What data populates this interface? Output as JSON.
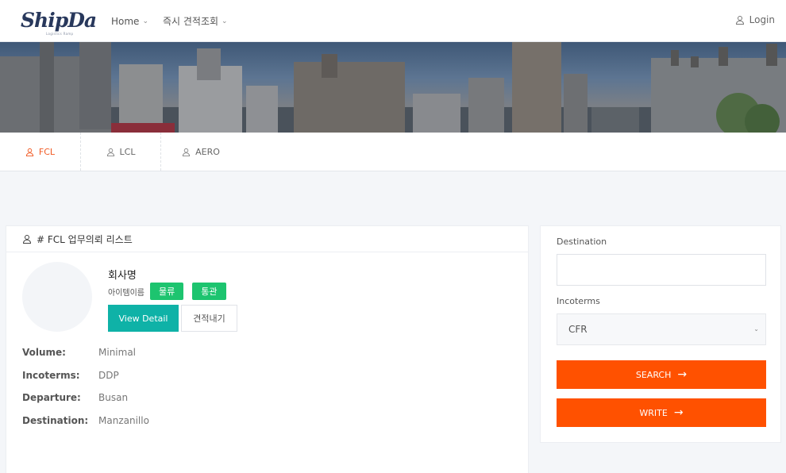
{
  "header": {
    "logo": "ShipDa",
    "logo_sub": "Logistics Ramp",
    "nav": [
      {
        "label": "Home"
      },
      {
        "label": "즉시 견적조회"
      }
    ],
    "login_label": "Login"
  },
  "tabs": [
    {
      "label": "FCL"
    },
    {
      "label": "LCL"
    },
    {
      "label": "AERO"
    }
  ],
  "list": {
    "title": "# FCL 업무의뢰 리스트",
    "item": {
      "company": "회사명",
      "item_name": "아이템이름",
      "badges": [
        "물류",
        "통관"
      ],
      "view_detail_label": "View Detail",
      "quote_label": "견적내기",
      "specs": [
        {
          "key": "Volume:",
          "value": "Minimal"
        },
        {
          "key": "Incoterms:",
          "value": "DDP"
        },
        {
          "key": "Departure:",
          "value": "Busan"
        },
        {
          "key": "Destination:",
          "value": "Manzanillo"
        }
      ]
    }
  },
  "filter": {
    "destination_label": "Destination",
    "destination_value": "",
    "incoterms_label": "Incoterms",
    "incoterms_value": "CFR",
    "search_label": "SEARCH",
    "write_label": "WRITE"
  },
  "colors": {
    "accent_orange": "#ff5100",
    "teal": "#0fb2a7",
    "badge_green": "#1dc46f",
    "tab_active": "#f15a24",
    "logo_navy": "#28385c"
  },
  "icons": {
    "user": "user-icon",
    "arrow": "arrow-right-icon",
    "chevron": "chevron-down-icon"
  }
}
